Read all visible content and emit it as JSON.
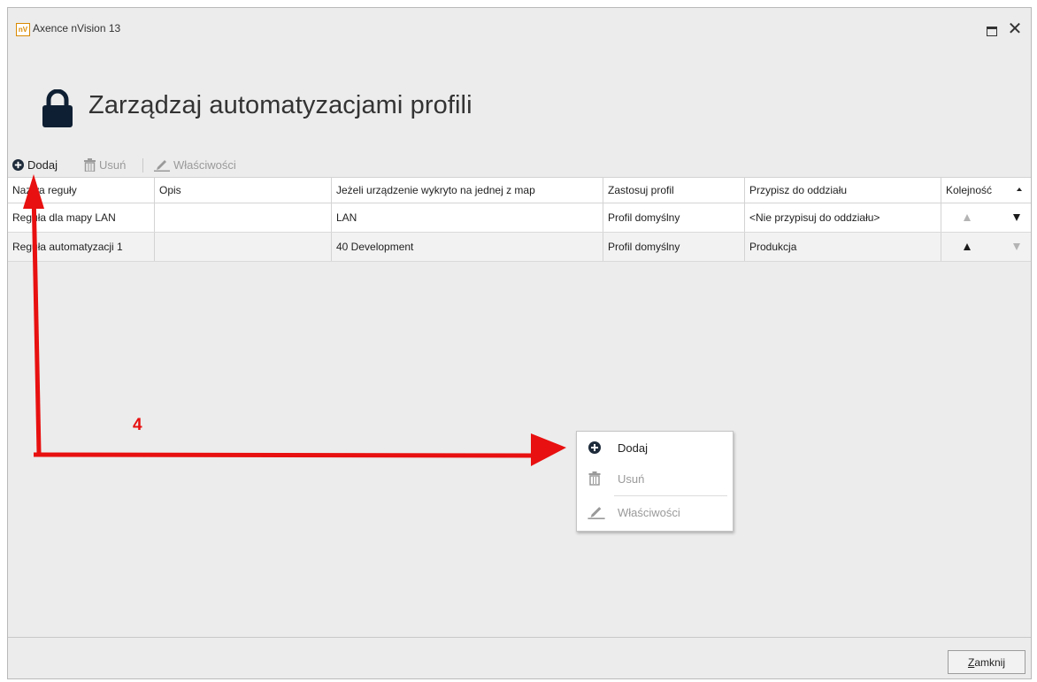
{
  "window": {
    "app_title": "Axence nVision 13",
    "logo_text": "nV",
    "close_glyph": "✕"
  },
  "header": {
    "title": "Zarządzaj automatyzacjami profili",
    "icon": "lock-icon"
  },
  "toolbar": {
    "add_label": "Dodaj",
    "delete_label": "Usuń",
    "properties_label": "Właściwości"
  },
  "table": {
    "columns": [
      "Nazwa reguły",
      "Opis",
      "Jeżeli urządzenie wykryto na jednej z map",
      "Zastosuj profil",
      "Przypisz do oddziału",
      "Kolejność"
    ],
    "rows": [
      {
        "name": "Reguła dla mapy LAN",
        "description": "",
        "map": "LAN",
        "profile": "Profil domyślny",
        "branch": "<Nie przypisuj do oddziału>",
        "order_up_enabled": false,
        "order_down_enabled": true
      },
      {
        "name": "Reguła automatyzacji 1",
        "description": "",
        "map": "40 Development",
        "profile": "Profil domyślny",
        "branch": "Produkcja",
        "order_up_enabled": true,
        "order_down_enabled": false
      }
    ]
  },
  "context_menu": {
    "add_label": "Dodaj",
    "delete_label": "Usuń",
    "properties_label": "Właściwości"
  },
  "footer": {
    "close_label_underlined": "Z",
    "close_label_rest": "amknij"
  },
  "annotation": {
    "step_number": "4",
    "color": "#e81010"
  },
  "colors": {
    "background": "#ececec",
    "accent_logo": "#d98a00"
  }
}
